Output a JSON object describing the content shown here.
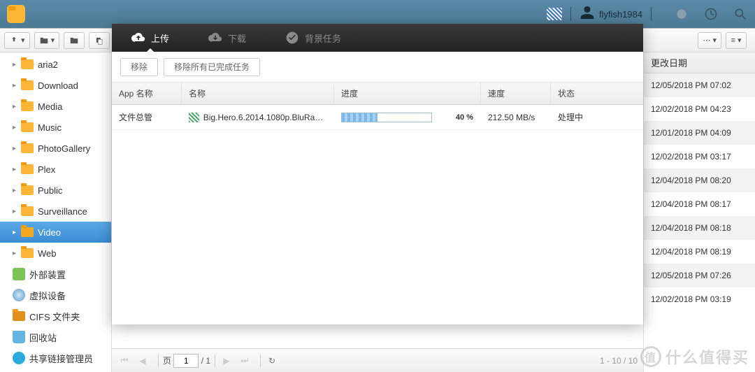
{
  "desktop": {
    "username": "flyfish1984"
  },
  "sidebar": {
    "items": [
      {
        "label": "aria2",
        "type": "folder",
        "indent": true,
        "caret": "▸"
      },
      {
        "label": "Download",
        "type": "folder",
        "indent": true,
        "caret": "▸"
      },
      {
        "label": "Media",
        "type": "folder",
        "indent": true,
        "caret": "▸"
      },
      {
        "label": "Music",
        "type": "folder",
        "indent": true,
        "caret": "▸"
      },
      {
        "label": "PhotoGallery",
        "type": "folder",
        "indent": true,
        "caret": "▸"
      },
      {
        "label": "Plex",
        "type": "folder",
        "indent": true,
        "caret": "▸"
      },
      {
        "label": "Public",
        "type": "folder",
        "indent": true,
        "caret": "▸"
      },
      {
        "label": "Surveillance",
        "type": "folder",
        "indent": true,
        "caret": "▸"
      },
      {
        "label": "Video",
        "type": "folder",
        "indent": true,
        "caret": "▸",
        "selected": true
      },
      {
        "label": "Web",
        "type": "folder",
        "indent": true,
        "caret": "▸"
      },
      {
        "label": "外部装置",
        "type": "ext",
        "indent": false,
        "caret": ""
      },
      {
        "label": "虚拟设备",
        "type": "virt",
        "indent": false,
        "caret": ""
      },
      {
        "label": "CIFS 文件夹",
        "type": "cifs",
        "indent": false,
        "caret": ""
      },
      {
        "label": "回收站",
        "type": "trash",
        "indent": false,
        "caret": ""
      },
      {
        "label": "共享链接管理员",
        "type": "share",
        "indent": false,
        "caret": ""
      }
    ]
  },
  "dates": {
    "header": "更改日期",
    "rows": [
      "12/05/2018 PM 07:02",
      "12/02/2018 PM 04:23",
      "12/01/2018 PM 04:09",
      "12/02/2018 PM 03:17",
      "12/04/2018 PM 08:20",
      "12/04/2018 PM 08:17",
      "12/04/2018 PM 08:18",
      "12/04/2018 PM 08:19",
      "12/05/2018 PM 07:26",
      "12/02/2018 PM 03:19"
    ]
  },
  "dialog": {
    "tabs": {
      "upload": "上传",
      "download": "下载",
      "background": "背景任务"
    },
    "actions": {
      "remove": "移除",
      "remove_done": "移除所有已完成任务"
    },
    "columns": {
      "app": "App 名称",
      "name": "名称",
      "progress": "进度",
      "speed": "速度",
      "status": "状态"
    },
    "rows": [
      {
        "app": "文件总管",
        "name": "Big.Hero.6.2014.1080p.BluRay.x2...",
        "progress_pct": 40,
        "progress_label": "40 %",
        "speed": "212.50 MB/s",
        "status": "处理中"
      }
    ]
  },
  "paging": {
    "page_label": "页",
    "page": "1",
    "total": "/ 1",
    "range": "1 - 10 / 10"
  },
  "watermark": {
    "badge": "值",
    "text": "什么值得买"
  }
}
